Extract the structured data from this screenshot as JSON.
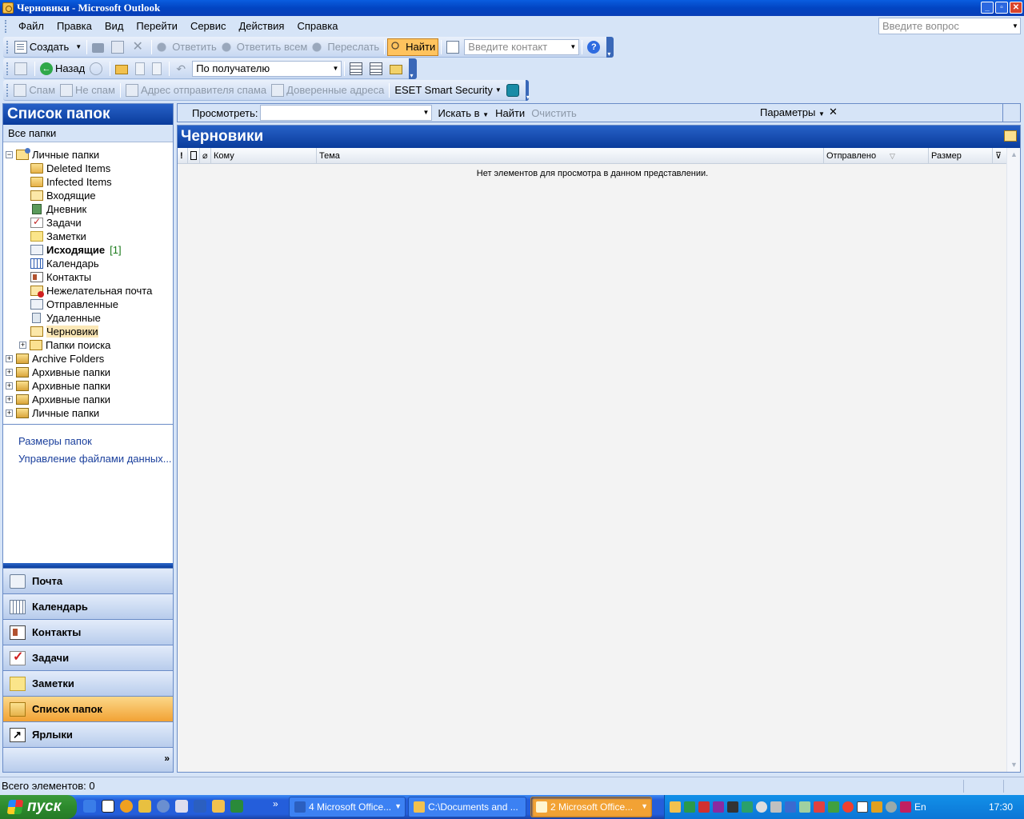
{
  "window": {
    "title": "Черновики - Microsoft Outlook"
  },
  "menu": {
    "items": [
      "Файл",
      "Правка",
      "Вид",
      "Перейти",
      "Сервис",
      "Действия",
      "Справка"
    ],
    "ask_placeholder": "Введите вопрос"
  },
  "toolbar1": {
    "create": "Создать",
    "reply": "Ответить",
    "reply_all": "Ответить всем",
    "forward": "Переслать",
    "find": "Найти",
    "contact_placeholder": "Введите контакт"
  },
  "toolbar2": {
    "back": "Назад",
    "arrange_by": "По получателю"
  },
  "toolbar3": {
    "spam": "Спам",
    "not_spam": "Не спам",
    "spam_sender": "Адрес отправителя спама",
    "trusted": "Доверенные адреса",
    "eset": "ESET Smart Security"
  },
  "folder_pane": {
    "title": "Список папок",
    "subtitle": "Все папки",
    "tree": [
      {
        "label": "Личные папки",
        "icon": "personal-folders-icon",
        "exp": "⊟"
      },
      {
        "label": "Deleted Items",
        "icon": "folder-icon"
      },
      {
        "label": "Infected Items",
        "icon": "folder-icon"
      },
      {
        "label": "Входящие",
        "icon": "inbox-icon"
      },
      {
        "label": "Дневник",
        "icon": "journal-icon"
      },
      {
        "label": "Задачи",
        "icon": "tasks-icon"
      },
      {
        "label": "Заметки",
        "icon": "notes-icon"
      },
      {
        "label": "Исходящие",
        "icon": "outbox-icon",
        "count": "[1]"
      },
      {
        "label": "Календарь",
        "icon": "calendar-icon"
      },
      {
        "label": "Контакты",
        "icon": "contacts-icon"
      },
      {
        "label": "Нежелательная почта",
        "icon": "junk-mail-icon"
      },
      {
        "label": "Отправленные",
        "icon": "sent-items-icon"
      },
      {
        "label": "Удаленные",
        "icon": "deleted-items-icon"
      },
      {
        "label": "Черновики",
        "icon": "drafts-icon"
      },
      {
        "label": "Папки поиска",
        "icon": "search-folders-icon"
      },
      {
        "label": "Archive Folders",
        "icon": "archive-icon"
      },
      {
        "label": "Архивные папки",
        "icon": "archive-icon"
      },
      {
        "label": "Архивные папки",
        "icon": "archive-icon"
      },
      {
        "label": "Архивные папки",
        "icon": "archive-icon"
      },
      {
        "label": "Личные папки",
        "icon": "archive-icon"
      }
    ],
    "links": [
      "Размеры папок",
      "Управление файлами данных..."
    ]
  },
  "nav_buttons": [
    "Почта",
    "Календарь",
    "Контакты",
    "Задачи",
    "Заметки",
    "Список папок",
    "Ярлыки"
  ],
  "search_bar": {
    "look_for_label": "Просмотреть:",
    "search_in": "Искать в",
    "find_now": "Найти",
    "clear": "Очистить",
    "options": "Параметры",
    "close": "✕"
  },
  "content": {
    "folder_title": "Черновики",
    "columns": {
      "importance": "!",
      "icon": "",
      "attachment": "",
      "to": "Кому",
      "subject": "Тема",
      "sent": "Отправлено",
      "size": "Размер"
    },
    "empty_message": "Нет элементов для просмотра в данном представлении."
  },
  "status": {
    "text": "Всего элементов: 0"
  },
  "taskbar": {
    "start": "пуск",
    "tasks": [
      "4 Microsoft Office...",
      "C:\\Documents and ...",
      "2 Microsoft Office..."
    ],
    "lang": "En",
    "clock": "17:30"
  },
  "colors": {
    "accent_blue": "#0a3c9c",
    "active_orange": "#f2a234",
    "background": "#d6e4f7"
  }
}
